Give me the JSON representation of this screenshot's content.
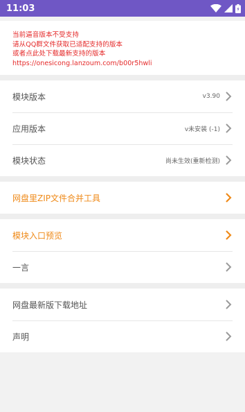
{
  "status_bar": {
    "time": "11:03",
    "icons": [
      "wifi-icon",
      "signal-icon",
      "battery-icon"
    ],
    "bg_color": "#6f57c5"
  },
  "notice": {
    "lines": [
      "当前逼音版本不受支持",
      "请从QQ群文件获取已适配支持的版本",
      "或者点此处下载最新支持的版本",
      "https://onesicong.lanzoum.com/b00r5hwli"
    ],
    "color": "#e52b2b"
  },
  "info_group": {
    "items": [
      {
        "label": "模块版本",
        "value": "v3.90"
      },
      {
        "label": "应用版本",
        "value": "v未安装 (-1)"
      },
      {
        "label": "模块状态",
        "value": "尚未生效(重新检测)"
      }
    ]
  },
  "tools_group": {
    "items": [
      {
        "label": "网盘里ZIP文件合并工具"
      }
    ]
  },
  "entry_group": {
    "items": [
      {
        "label": "模块入口预览"
      },
      {
        "label": "一言"
      }
    ]
  },
  "download_group": {
    "items": [
      {
        "label": "网盘最新版下载地址"
      },
      {
        "label": "声明"
      }
    ]
  },
  "colors": {
    "accent": "#ef8a19",
    "label_gray": "#555555",
    "chevron_gray": "#9a9a9a"
  }
}
